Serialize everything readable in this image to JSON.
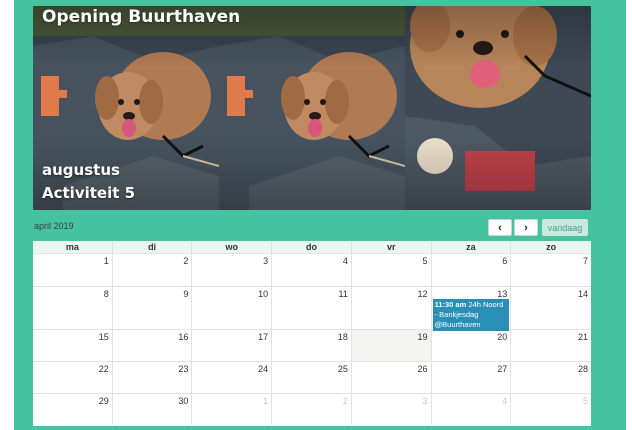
{
  "banner": {
    "title": "Opening Buurthaven",
    "month": "augustus",
    "activity": "Activiteit 5"
  },
  "calendar": {
    "month_label": "april 2019",
    "prev_icon": "‹",
    "next_icon": "›",
    "today_label": "vandaag",
    "weekdays": [
      "ma",
      "di",
      "wo",
      "do",
      "vr",
      "za",
      "zo"
    ],
    "weeks": [
      [
        "1",
        "2",
        "3",
        "4",
        "5",
        "6",
        "7"
      ],
      [
        "8",
        "9",
        "10",
        "11",
        "12",
        "13",
        "14"
      ],
      [
        "15",
        "16",
        "17",
        "18",
        "19",
        "20",
        "21"
      ],
      [
        "22",
        "23",
        "24",
        "25",
        "26",
        "27",
        "28"
      ],
      [
        "29",
        "30",
        "1",
        "2",
        "3",
        "4",
        "5"
      ]
    ],
    "event": {
      "time": "11:30 am",
      "title": "24h Noord - Bankjesdag @Buurthaven",
      "color": "#2a8fb5"
    }
  },
  "colors": {
    "frame": "#45c3a1",
    "accent": "#2a8fb5"
  }
}
